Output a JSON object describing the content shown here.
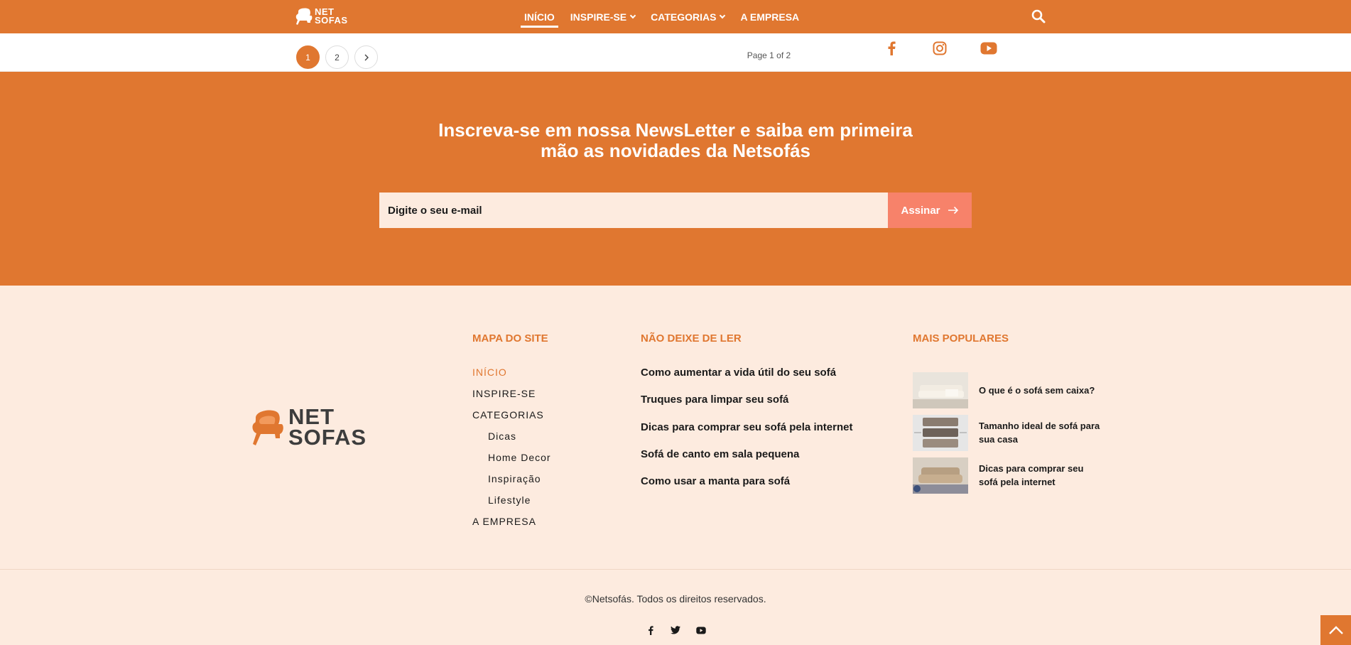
{
  "brand": {
    "line1": "NET",
    "line2": "SOFAS"
  },
  "nav": {
    "items": [
      {
        "label": "INÍCIO",
        "active": true
      },
      {
        "label": "INSPIRE-SE",
        "dropdown": true
      },
      {
        "label": "CATEGORIAS",
        "dropdown": true
      },
      {
        "label": "A EMPRESA"
      }
    ],
    "search_icon": "search-icon"
  },
  "pagination": {
    "pages": [
      "1",
      "2"
    ],
    "current": "1",
    "next_icon": "chevron-right-icon",
    "info": "Page 1 of 2"
  },
  "social_icons": [
    "facebook-icon",
    "instagram-icon",
    "youtube-icon"
  ],
  "newsletter": {
    "title_line1": "Inscreva-se em nossa NewsLetter e saiba em primeira",
    "title_line2": "mão as novidades da Netsofás",
    "placeholder": "Digite o seu e-mail",
    "button": "Assinar"
  },
  "footer": {
    "sitemap": {
      "heading": "MAPA DO SITE",
      "items": [
        "INÍCIO",
        "INSPIRE-SE",
        "CATEGORIAS",
        "Dicas",
        "Home Decor",
        "Inspiração",
        "Lifestyle",
        "A EMPRESA"
      ]
    },
    "must_read": {
      "heading": "NÃO DEIXE DE LER",
      "items": [
        "Como aumentar a vida útil do seu sofá",
        "Truques para limpar seu sofá",
        "Dicas para comprar seu sofá pela internet",
        "Sofá de canto em sala pequena",
        "Como usar a manta para sofá"
      ]
    },
    "popular": {
      "heading": "MAIS POPULARES",
      "items": [
        "O que é o sofá sem caixa?",
        "Tamanho ideal de sofá para sua casa",
        "Dicas para comprar seu sofá pela internet"
      ]
    },
    "copyright": "©Netsofás. Todos os direitos reservados.",
    "social_icons": [
      "facebook-icon",
      "twitter-icon",
      "youtube-icon"
    ]
  },
  "colors": {
    "accent": "#e07730",
    "button": "#f7826a",
    "footer_bg": "#fdebdf"
  }
}
